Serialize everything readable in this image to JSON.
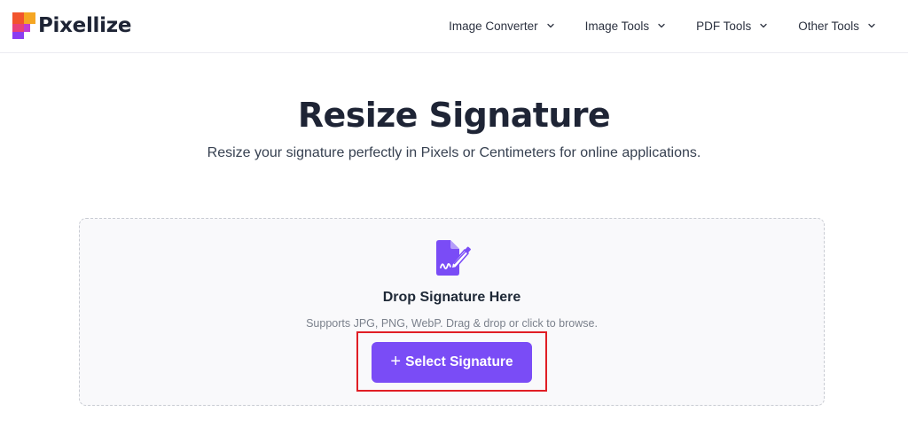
{
  "header": {
    "brand": "Pixellize",
    "nav": [
      {
        "label": "Image Converter",
        "icon": "chevron-down-icon"
      },
      {
        "label": "Image Tools",
        "icon": "chevron-down-icon"
      },
      {
        "label": "PDF Tools",
        "icon": "chevron-down-icon"
      },
      {
        "label": "Other Tools",
        "icon": "chevron-down-icon"
      }
    ]
  },
  "hero": {
    "title": "Resize Signature",
    "subtitle": "Resize your signature perfectly in Pixels or Centimeters for online applications."
  },
  "dropzone": {
    "icon": "signature-file-icon",
    "title": "Drop Signature Here",
    "hint": "Supports JPG, PNG, WebP. Drag & drop or click to browse.",
    "button_icon": "plus-icon",
    "button_label": "Select Signature"
  },
  "colors": {
    "accent": "#7a4cf6",
    "highlight": "#e01e25",
    "text_dark": "#1e2435",
    "logo": [
      "#f2542d",
      "#f5a623",
      "#e8417a",
      "#8b3df2"
    ]
  }
}
